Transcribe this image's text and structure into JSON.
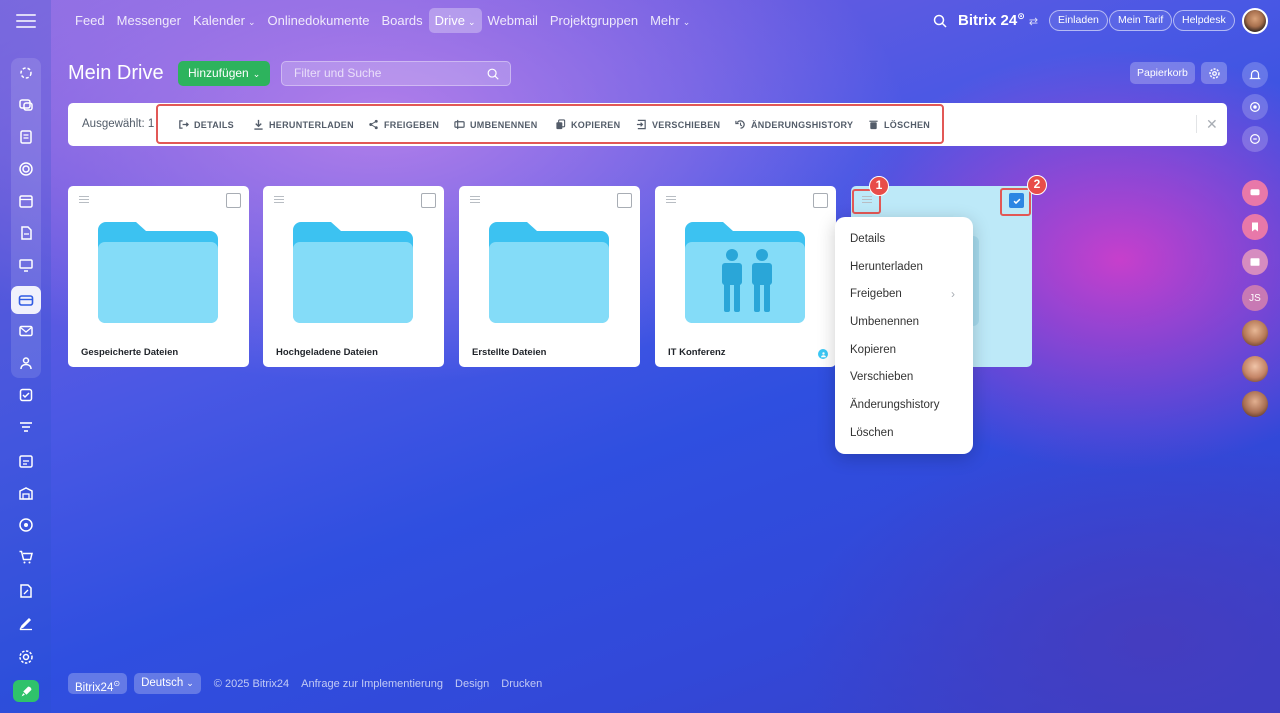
{
  "colors": {
    "accent_green": "#2db35d",
    "highlight_red": "#e25856",
    "badge_red": "#e84d4a",
    "folder_blue": "#7fd6f7",
    "selected_card": "#bde9f8",
    "checkbox_blue": "#2d86e3"
  },
  "nav": {
    "items": [
      "Feed",
      "Messenger",
      "Kalender",
      "Onlinedokumente",
      "Boards",
      "Drive",
      "Webmail",
      "Projektgruppen",
      "Mehr"
    ],
    "active": "Drive"
  },
  "top": {
    "brand": "Bitrix 24",
    "brand_mark": "⊙",
    "invite": "Einladen",
    "tariff": "Mein Tarif",
    "helpdesk": "Helpdesk"
  },
  "page": {
    "title": "Mein Drive",
    "add_label": "Hinzufügen",
    "filter_placeholder": "Filter und Suche",
    "trash": "Papierkorb"
  },
  "toolbar": {
    "selected": "Ausgewählt: 1",
    "actions": [
      "DETAILS",
      "HERUNTERLADEN",
      "FREIGEBEN",
      "UMBENENNEN",
      "KOPIEREN",
      "VERSCHIEBEN",
      "ÄNDERUNGSHISTORY",
      "LÖSCHEN"
    ]
  },
  "cards": [
    {
      "name": "Gespeicherte Dateien",
      "type": "folder"
    },
    {
      "name": "Hochgeladene Dateien",
      "type": "folder"
    },
    {
      "name": "Erstellte Dateien",
      "type": "folder"
    },
    {
      "name": "IT Konferenz",
      "type": "shared-folder"
    },
    {
      "name": "",
      "type": "file",
      "selected": true
    }
  ],
  "callouts": [
    "1",
    "2"
  ],
  "context_menu": [
    "Details",
    "Herunterladen",
    "Freigeben",
    "Umbenennen",
    "Kopieren",
    "Verschieben",
    "Änderungshistory",
    "Löschen"
  ],
  "right_sidebar": {
    "initials": "JS"
  },
  "footer": {
    "brand": "Bitrix24",
    "brand_mark": "⊙",
    "language": "Deutsch",
    "copyright": "© 2025 Bitrix24",
    "links": [
      "Anfrage zur Implementierung",
      "Design",
      "Drucken"
    ]
  }
}
